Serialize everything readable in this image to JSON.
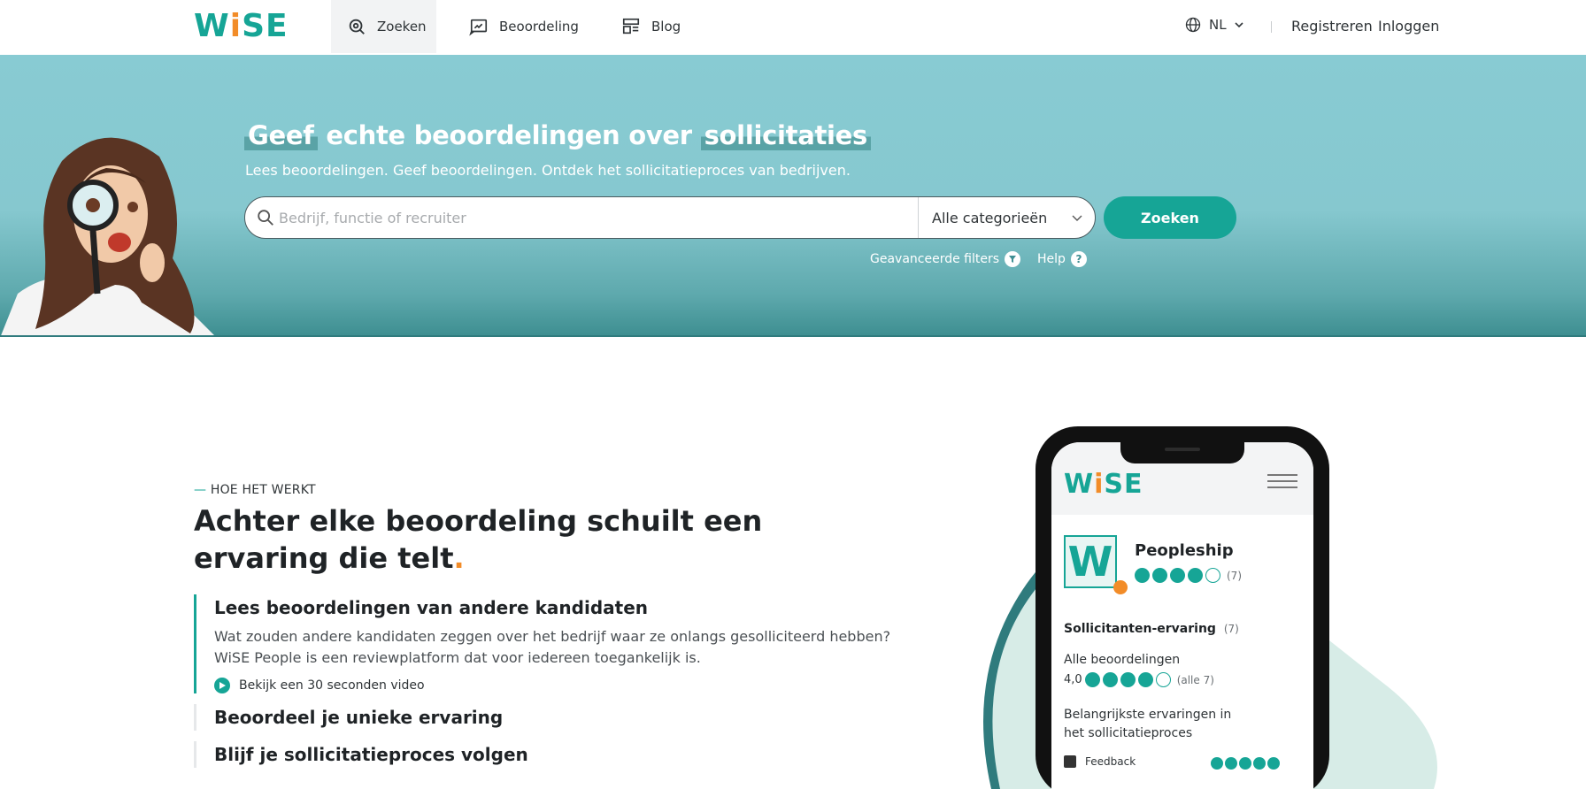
{
  "header": {
    "logo": "WiSE",
    "nav": [
      {
        "label": "Zoeken",
        "icon": "search-icon",
        "active": true
      },
      {
        "label": "Beoordeling",
        "icon": "review-icon",
        "active": false
      },
      {
        "label": "Blog",
        "icon": "blog-icon",
        "active": false
      }
    ],
    "language": "NL",
    "register": "Registreren",
    "login": "Inloggen"
  },
  "hero": {
    "title_part1": "Geef",
    "title_part2": "echte beoordelingen over",
    "title_part3": "sollicitaties",
    "subtitle": "Lees beoordelingen. Geef beoordelingen. Ontdek het sollicitatieproces van bedrijven.",
    "search_placeholder": "Bedrijf, functie of recruiter",
    "category_selected": "Alle categorieën",
    "search_button": "Zoeken",
    "advanced_filters": "Geavanceerde filters",
    "help": "Help"
  },
  "how": {
    "eyebrow_dash": "—",
    "eyebrow": "HOE HET WERKT",
    "title": "Achter elke beoordeling schuilt een ervaring die telt",
    "title_period": ".",
    "steps": [
      {
        "title": "Lees beoordelingen van andere kandidaten",
        "body": "Wat zouden andere kandidaten zeggen over het bedrijf waar ze onlangs gesolliciteerd hebben? WiSE People is een reviewplatform dat voor iedereen toegankelijk is.",
        "link": "Bekijk een 30 seconden video"
      },
      {
        "title": "Beoordeel je unieke ervaring"
      },
      {
        "title": "Blijf je sollicitatieproces volgen"
      }
    ]
  },
  "phone": {
    "logo": "WiSE",
    "company_initial": "W",
    "company_name": "Peopleship",
    "rating_filled": 4,
    "rating_count": "(7)",
    "section_label": "Sollicitanten-ervaring",
    "section_count": "(7)",
    "all_reviews": "Alle beoordelingen",
    "all_score": "4,0",
    "all_count": "(alle 7)",
    "key_experiences": "Belangrijkste ervaringen in het sollicitatieproces",
    "feedback": "Feedback"
  },
  "colors": {
    "brand": "#16a596",
    "accent": "#f28c28",
    "hero_bg": "#88cbd3"
  }
}
